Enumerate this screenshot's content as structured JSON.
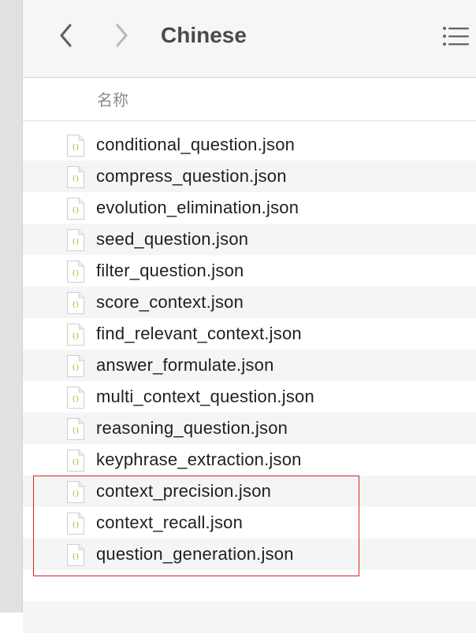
{
  "window": {
    "title": "Chinese",
    "back_icon": "chevron-left-icon",
    "forward_icon": "chevron-right-icon",
    "view_icon": "list-view-icon"
  },
  "header": {
    "name_column": "名称"
  },
  "files": [
    {
      "name": "conditional_question.json",
      "icon": "json-file-icon"
    },
    {
      "name": "compress_question.json",
      "icon": "json-file-icon"
    },
    {
      "name": "evolution_elimination.json",
      "icon": "json-file-icon"
    },
    {
      "name": "seed_question.json",
      "icon": "json-file-icon"
    },
    {
      "name": "filter_question.json",
      "icon": "json-file-icon"
    },
    {
      "name": "score_context.json",
      "icon": "json-file-icon"
    },
    {
      "name": "find_relevant_context.json",
      "icon": "json-file-icon"
    },
    {
      "name": "answer_formulate.json",
      "icon": "json-file-icon"
    },
    {
      "name": "multi_context_question.json",
      "icon": "json-file-icon"
    },
    {
      "name": "reasoning_question.json",
      "icon": "json-file-icon"
    },
    {
      "name": "keyphrase_extraction.json",
      "icon": "json-file-icon"
    },
    {
      "name": "context_precision.json",
      "icon": "json-file-icon"
    },
    {
      "name": "context_recall.json",
      "icon": "json-file-icon"
    },
    {
      "name": "question_generation.json",
      "icon": "json-file-icon"
    }
  ],
  "icon_badge": "{}",
  "colors": {
    "highlight_box": "#d9202a",
    "alt_row": "#f4f5f5",
    "icon_badge": "#a8b51f"
  }
}
